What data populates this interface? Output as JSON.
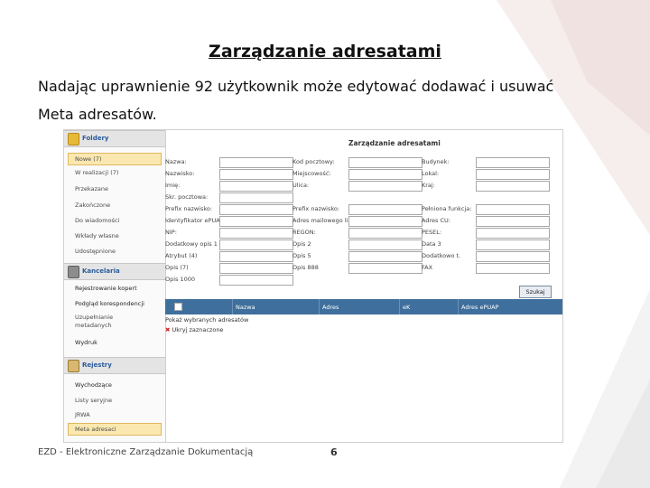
{
  "slide": {
    "title": "Zarządzanie adresatami",
    "line1": "Nadając uprawnienie 92 użytkownik może edytować dodawać i usuwać",
    "line2": "Meta adresatów.",
    "footer": "EZD - Elektroniczne Zarządzanie Dokumentacją",
    "page_number": "6"
  },
  "sidebar": {
    "folders": {
      "header": "Foldery",
      "items": [
        "Nowe (7)",
        "W realizacji (7)",
        "Przekazane",
        "Zakończone",
        "Do wiadomości",
        "Wkłady własne",
        "Udostępnione"
      ]
    },
    "office": {
      "header": "Kancelaria",
      "items": [
        "Rejestrowanie kopert",
        "Podgląd korespondencji",
        "Uzupełnianie metadanych",
        "Wydruk"
      ]
    },
    "registers": {
      "header": "Rejestry",
      "items": [
        "Wychodzące",
        "Listy seryjne",
        "JRWA",
        "Meta adresaci"
      ],
      "selected_index": 3
    }
  },
  "form": {
    "title": "Zarządzanie adresatami",
    "col1": [
      "Nazwa:",
      "Nazwisko:",
      "Imię:",
      "Skr. pocztowa:",
      "Prefix nazwisko:",
      "Identyfikator ePUAP:",
      "NIP:",
      "Dodatkowy opis 1",
      "Atrybut (4)",
      "Opis (7)",
      "Opis 1000"
    ],
    "col2": [
      "Kod pocztowy:",
      "Miejscowość:",
      "Ulica:",
      "Prefix nazwisko:",
      "Adres mailowego lista:",
      "REGON:",
      "Opis 2",
      "Opis 5",
      "Opis 888"
    ],
    "col3": [
      "Budynek:",
      "Lokal:",
      "Kraj:",
      "Pełniona funkcja:",
      "Adres CU:",
      "PESEL:",
      "Data 3",
      "Dodatkowo t.",
      "FAX"
    ],
    "search_label": "Szukaj"
  },
  "grid": {
    "columns": [
      "Nazwa",
      "Adres",
      "eK",
      "Adres ePUAP"
    ],
    "row1": "Pokaż wybranych adresatów",
    "row2": "Ukryj zaznaczone"
  }
}
